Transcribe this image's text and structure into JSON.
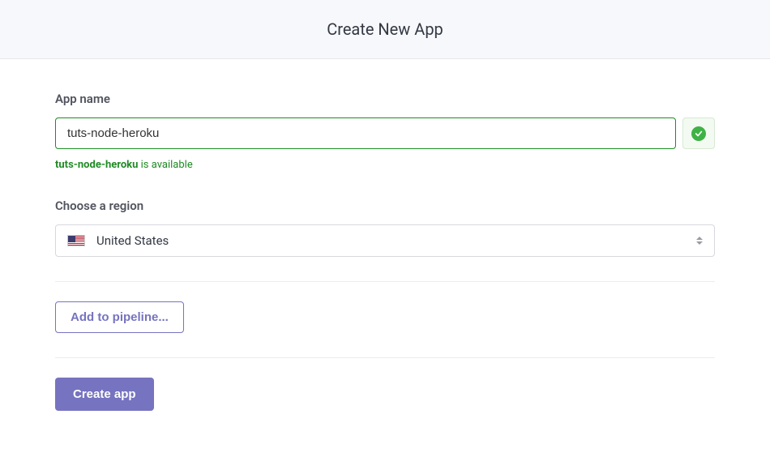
{
  "header": {
    "title": "Create New App"
  },
  "form": {
    "app_name": {
      "label": "App name",
      "value": "tuts-node-heroku",
      "availability_name": "tuts-node-heroku",
      "availability_suffix": " is available"
    },
    "region": {
      "label": "Choose a region",
      "selected": "United States"
    }
  },
  "actions": {
    "add_pipeline": "Add to pipeline...",
    "create": "Create app"
  },
  "colors": {
    "accent": "#7673c0",
    "success": "#1f8b24"
  }
}
